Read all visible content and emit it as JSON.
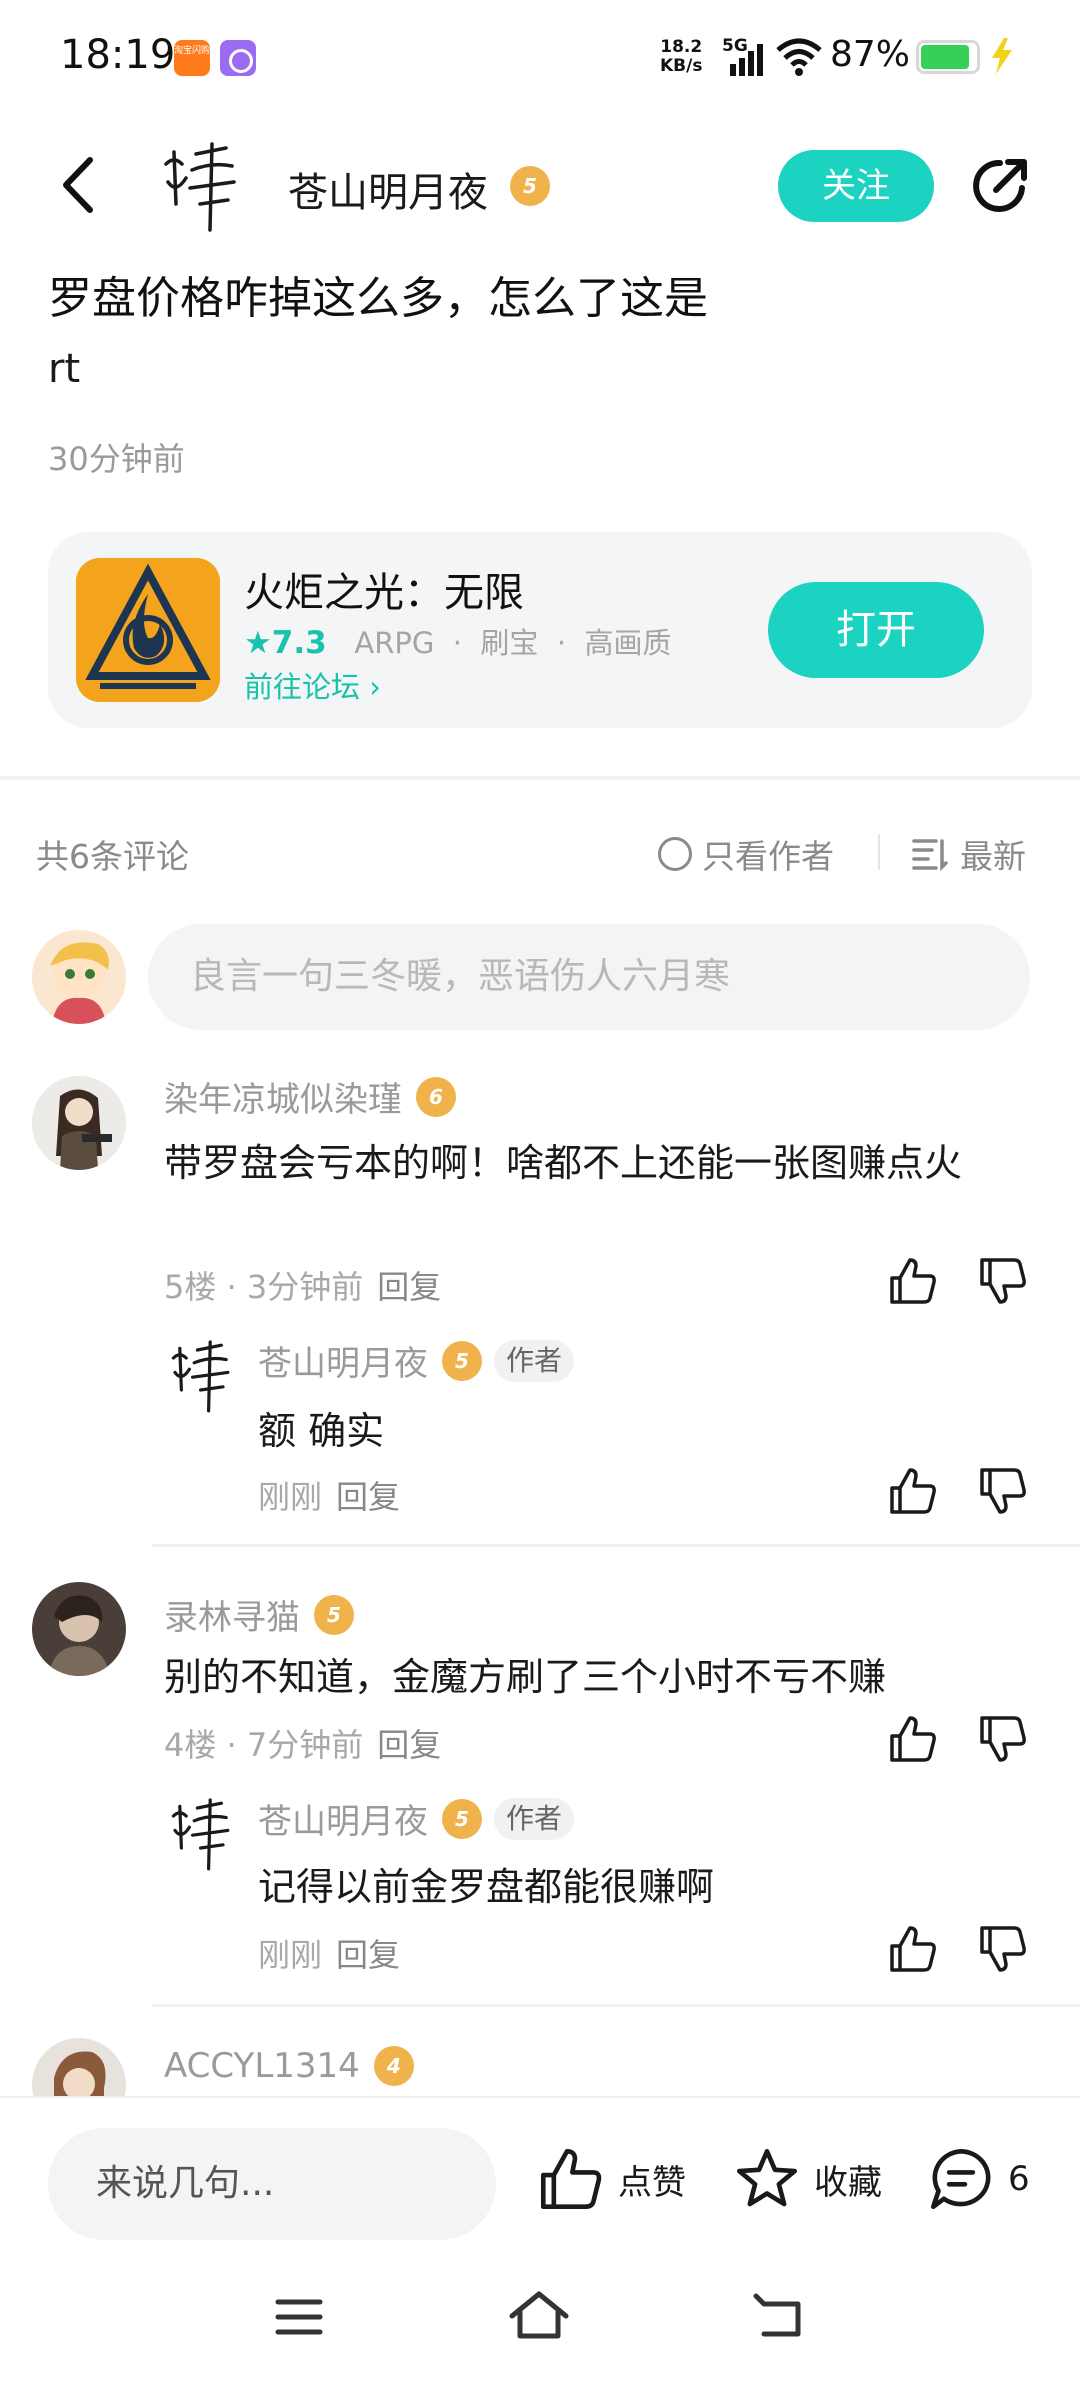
{
  "status_bar": {
    "time": "18:19",
    "net_speed_value": "18.2",
    "net_speed_unit": "KB/s",
    "network": "5G",
    "battery_percent": "87%",
    "battery_level": 0.87,
    "notif_app1_name": "淘宝闪购"
  },
  "header": {
    "author_name": "苍山明月夜",
    "author_level": "5",
    "follow_label": "关注"
  },
  "post": {
    "title": "罗盘价格咋掉这么多，怎么了这是",
    "body": "rt",
    "time": "30分钟前"
  },
  "game_card": {
    "name": "火炬之光：无限",
    "score": "7.3",
    "tags": [
      "ARPG",
      "刷宝",
      "高画质"
    ],
    "forum_link": "前往论坛",
    "open_label": "打开"
  },
  "comments_header": {
    "count_label": "共6条评论",
    "author_only_label": "只看作者",
    "sort_label": "最新"
  },
  "compose": {
    "placeholder": "良言一句三冬暖，恶语伤人六月寒"
  },
  "comments": [
    {
      "name": "染年凉城似染瑾",
      "level": "6",
      "text": "带罗盘会亏本的啊！啥都不上还能一张图赚点火",
      "meta": "5楼 · 3分钟前",
      "reply_label": "回复",
      "reply": {
        "name": "苍山明月夜",
        "level": "5",
        "tag": "作者",
        "text": "额 确实",
        "meta": "刚刚",
        "reply_label": "回复"
      }
    },
    {
      "name": "录林寻猫",
      "level": "5",
      "text": "别的不知道，金魔方刷了三个小时不亏不赚",
      "meta": "4楼 · 7分钟前",
      "reply_label": "回复",
      "reply": {
        "name": "苍山明月夜",
        "level": "5",
        "tag": "作者",
        "text": "记得以前金罗盘都能很赚啊",
        "meta": "刚刚",
        "reply_label": "回复"
      }
    },
    {
      "name": "ACCYL1314",
      "level": "4"
    }
  ],
  "bottom_bar": {
    "input_placeholder": "来说几句...",
    "like_label": "点赞",
    "favorite_label": "收藏",
    "comment_count": "6"
  },
  "colors": {
    "accent": "#1cd2c0",
    "accent_text": "#18c2ad",
    "level_badge": "#f0b24a"
  }
}
